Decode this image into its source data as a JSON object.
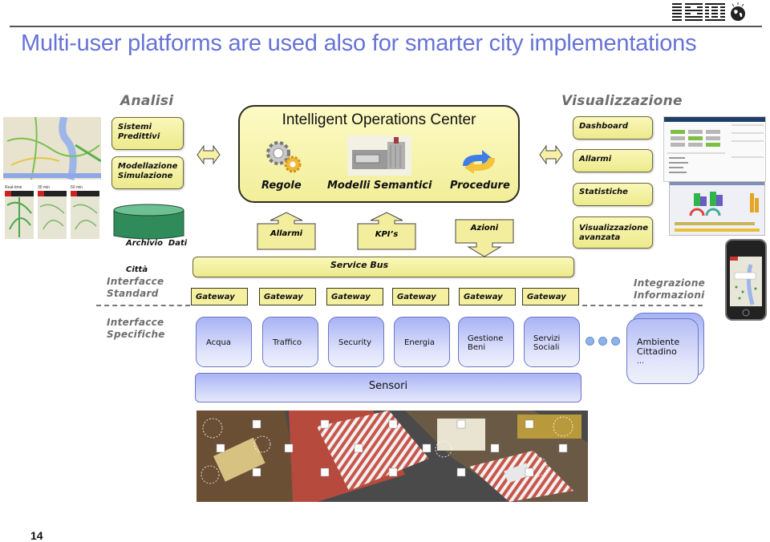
{
  "header": {
    "logo": "IBM",
    "globe_icon": "smarter-planet-globe-icon",
    "title": "Multi-user platforms are used also for smarter city implementations"
  },
  "sections": {
    "analisi": "Analisi",
    "visualizzazione": "Visualizzazione",
    "interfacce_standard": [
      "Interfacce",
      "Standard"
    ],
    "interfacce_specifiche": [
      "Interfacce",
      "Specifiche"
    ],
    "integrazione_informazioni": [
      "Integrazione",
      "Informazioni"
    ]
  },
  "analisi_boxes": [
    {
      "lines": [
        "Sistemi",
        "Predittivi"
      ]
    },
    {
      "lines": [
        "Modellazione",
        "Simulazione"
      ]
    }
  ],
  "archive": {
    "lines": [
      "Archivio  Dati",
      "Città"
    ]
  },
  "ioc": {
    "title": "Intelligent Operations Center",
    "components": [
      {
        "label": "Regole",
        "icon": "gears-icon"
      },
      {
        "label": "Modelli Semantici",
        "icon": "building-icon"
      },
      {
        "label": "Procedure",
        "icon": "cycle-arrows-icon"
      }
    ]
  },
  "flows": [
    {
      "label": "Allarmi",
      "direction": "up"
    },
    {
      "label": "KPI’s",
      "direction": "up"
    },
    {
      "label": "Azioni",
      "direction": "down"
    }
  ],
  "visual_boxes": [
    {
      "lines": [
        "Dashboard"
      ]
    },
    {
      "lines": [
        "Allarmi"
      ]
    },
    {
      "lines": [
        "Statistiche"
      ]
    },
    {
      "lines": [
        "Visualizzazione",
        "avanzata"
      ]
    }
  ],
  "service_bus": "Service Bus",
  "gateways": [
    "Gateway",
    "Gateway",
    "Gateway",
    "Gateway",
    "Gateway",
    "Gateway"
  ],
  "domains": [
    {
      "lines": [
        "Acqua"
      ]
    },
    {
      "lines": [
        "Traffico"
      ]
    },
    {
      "lines": [
        "Security"
      ]
    },
    {
      "lines": [
        "Energia"
      ]
    },
    {
      "lines": [
        "Gestione",
        "Beni"
      ]
    },
    {
      "lines": [
        "Servizi",
        "Sociali"
      ]
    }
  ],
  "ellipsis_dots": 3,
  "ambiente": {
    "lines": [
      "Ambiente",
      "Cittadino",
      "…"
    ]
  },
  "sensori": "Sensori",
  "images": {
    "traffic_maps": "traffic-map-screenshots",
    "dashboard": "dashboard-screenshot",
    "statistics": "statistics-screenshot",
    "smartphone": "smartphone-map-app",
    "city_sensors": "city-intersection-sensors-photo"
  },
  "page_number": "14"
}
